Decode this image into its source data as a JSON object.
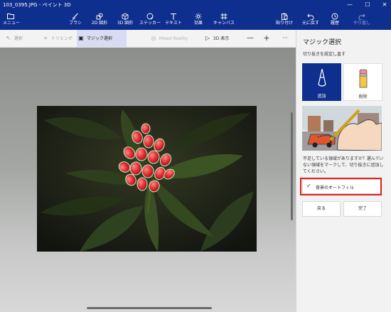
{
  "window": {
    "title": "103_0395.JPG - ペイント 3D",
    "minimize_glyph": "—",
    "maximize_glyph": "☐",
    "close_glyph": "✕"
  },
  "ribbon": {
    "menu": {
      "label": "メニュー",
      "icon": "folder-icon"
    },
    "tools": [
      {
        "label": "ブラシ",
        "icon": "brush-icon"
      },
      {
        "label": "2D 図形",
        "icon": "2d-shapes-icon"
      },
      {
        "label": "3D 図形",
        "icon": "3d-shapes-icon"
      },
      {
        "label": "ステッカー",
        "icon": "sticker-icon"
      },
      {
        "label": "テキスト",
        "icon": "text-icon"
      },
      {
        "label": "効果",
        "icon": "effects-icon"
      },
      {
        "label": "キャンバス",
        "icon": "canvas-icon"
      }
    ],
    "actions": [
      {
        "label": "貼り付け",
        "icon": "paste-icon"
      },
      {
        "label": "元に戻す",
        "icon": "undo-icon"
      },
      {
        "label": "履歴",
        "icon": "history-icon"
      },
      {
        "label": "やり直し",
        "icon": "redo-icon",
        "enabled": false
      }
    ]
  },
  "toolbar": {
    "select": "選択",
    "crop": "トリミング",
    "magic_select": "マジック選択",
    "mixed_reality": "Mixed Reality",
    "view_3d": "3D 表示",
    "zoom_out": "—",
    "zoom_in": "+",
    "more": "···",
    "active_tool": "マジック選択"
  },
  "panel": {
    "title": "マジック選択",
    "subtitle": "切り抜きを設定し直す",
    "modes": [
      {
        "label": "追加",
        "icon": "add-pen-icon",
        "selected": true
      },
      {
        "label": "削除",
        "icon": "eraser-icon",
        "selected": false
      }
    ],
    "description": "不足している領域がありますか？選んでいない領域をマークして、切り抜きに追加してください。",
    "autofill": {
      "label": "背景のオートフィル",
      "checked": true,
      "check_glyph": "✓"
    },
    "buttons": {
      "back": "戻る",
      "done": "完了"
    }
  },
  "colors": {
    "ribbon_bg": "#0f2f8e",
    "active_tool_bg": "#d9dbf3",
    "highlight_box": "#e0201c",
    "flower_red": "#e12a2f"
  }
}
